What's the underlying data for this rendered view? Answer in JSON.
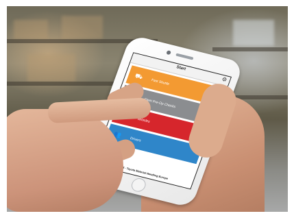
{
  "app": {
    "title": "Start",
    "settings_icon": "gear-icon"
  },
  "menu": [
    {
      "label": "Fast Shuttle",
      "color": "#f39a32",
      "icon": "forklift-icon",
      "glyph": "⛟"
    },
    {
      "label": "Fleet Pre-Op Checks",
      "color": "#8b8d90",
      "icon": "checklist-icon",
      "glyph": "☑"
    },
    {
      "label": "Vehicles",
      "color": "#d6262c",
      "icon": "truck-icon",
      "glyph": "⛟"
    },
    {
      "label": "Drivers",
      "color": "#2f86c9",
      "icon": "people-icon",
      "glyph": "👥"
    }
  ],
  "footer": "2014 - Toyota Material Handling Europe"
}
